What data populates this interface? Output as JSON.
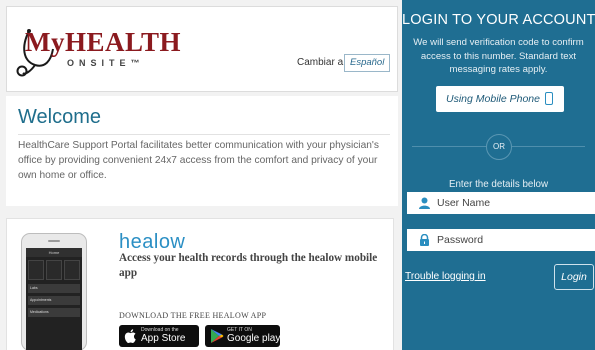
{
  "logo": {
    "main": "MyHEALTH",
    "sub": "ONSITE™"
  },
  "language": {
    "prompt": "Cambiar a",
    "button": "Español"
  },
  "welcome": {
    "title": "Welcome",
    "text": "HealthCare Support Portal facilitates better communication with your physician's office by providing convenient 24x7 access from the comfort and privacy of your own home or office."
  },
  "healow": {
    "logo": "healow",
    "headline": "Access your health records through the healow mobile app",
    "download_text": "DOWNLOAD THE FREE HEALOW APP",
    "app_store": {
      "small": "Download on the",
      "big": "App Store"
    },
    "google_play": {
      "small": "GET IT ON",
      "big": "Google play"
    },
    "phone_screen": {
      "title": "Home",
      "rows": [
        "Labs",
        "Appointments",
        "Medications"
      ]
    }
  },
  "login": {
    "title": "LOGIN TO YOUR ACCOUNT",
    "description": "We will send verification code to confirm access to this number. Standard text messaging rates apply.",
    "mobile_button": "Using Mobile Phone",
    "or_label": "OR",
    "details_label": "Enter the details below",
    "username_placeholder": "User Name",
    "password_placeholder": "Password",
    "trouble_link": "Trouble logging in",
    "login_button": "Login"
  },
  "colors": {
    "panel": "#1f6e92",
    "brand": "#8b1a1f",
    "accent": "#2b8fc4"
  }
}
